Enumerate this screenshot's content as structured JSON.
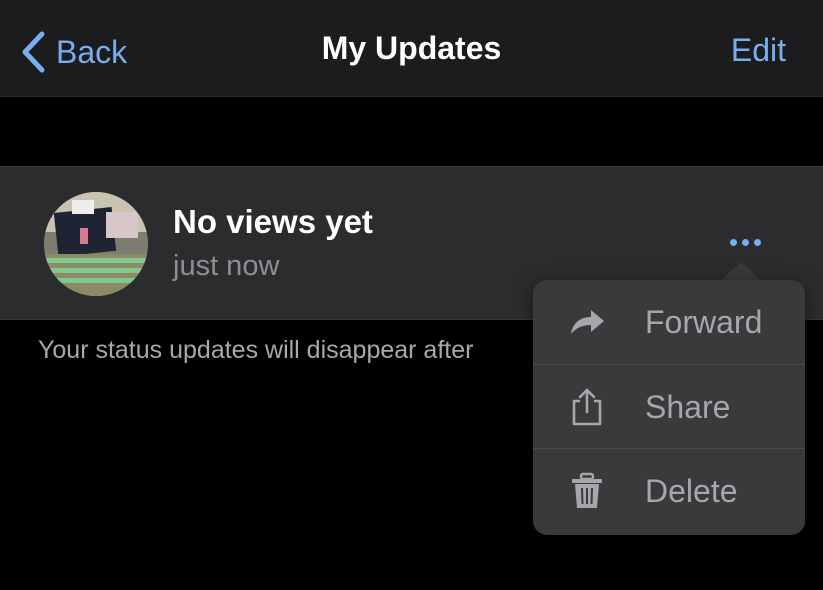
{
  "navbar": {
    "back_label": "Back",
    "title": "My Updates",
    "edit_label": "Edit"
  },
  "status": {
    "title": "No views yet",
    "time": "just now"
  },
  "footer": {
    "note": "Your status updates will disappear after"
  },
  "menu": {
    "items": [
      {
        "label": "Forward",
        "icon": "forward-icon"
      },
      {
        "label": "Share",
        "icon": "share-icon"
      },
      {
        "label": "Delete",
        "icon": "trash-icon"
      }
    ]
  },
  "colors": {
    "accent": "#78aef0",
    "background": "#000000",
    "navbar": "#1c1c1e",
    "row": "#2c2c2e",
    "menu": "#3a3a3c"
  }
}
